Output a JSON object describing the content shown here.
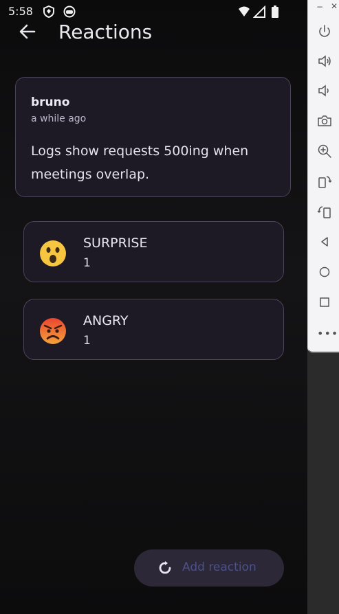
{
  "status_bar": {
    "time": "5:58"
  },
  "app_bar": {
    "title": "Reactions"
  },
  "post": {
    "author": "bruno",
    "time": "a while ago",
    "body": "Logs show requests 500ing when meetings overlap."
  },
  "reactions": [
    {
      "name": "SURPRISE",
      "count": "1",
      "emoji": "astonished-face-icon"
    },
    {
      "name": "ANGRY",
      "count": "1",
      "emoji": "angry-face-icon"
    }
  ],
  "fab": {
    "label": "Add reaction",
    "icon": "refresh-icon"
  },
  "emulator_panel": {
    "buttons": [
      "power-icon",
      "volume-up-icon",
      "volume-down-icon",
      "camera-icon",
      "zoom-icon",
      "rotate-left-icon",
      "rotate-right-icon",
      "back-icon",
      "home-icon",
      "overview-icon"
    ],
    "more": "•••"
  },
  "colors": {
    "accent": "#4c5187",
    "card": "#1d1a26",
    "border": "#4a4558"
  }
}
